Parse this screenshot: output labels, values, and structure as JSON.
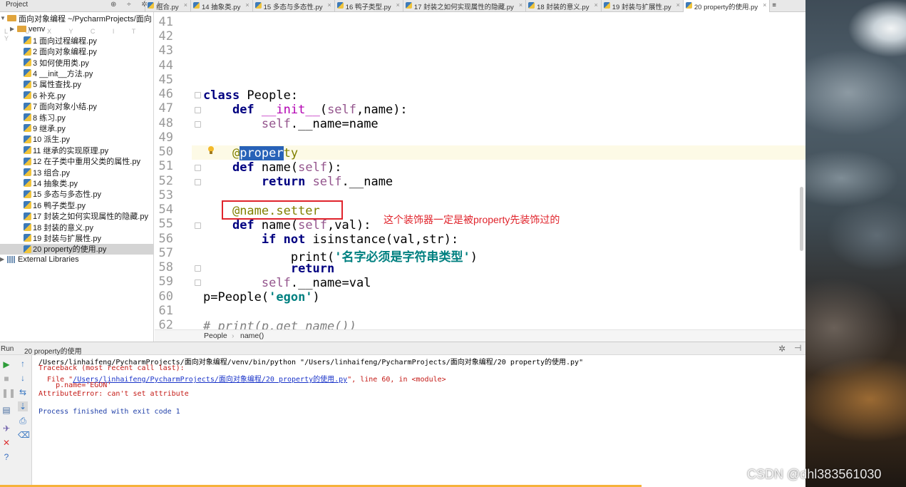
{
  "topbar": {
    "project_label": "Project",
    "tools": "⊕ ÷ ✲ ⊢",
    "tabs": [
      {
        "label": "组合.py",
        "active": false
      },
      {
        "label": "14 抽象类.py",
        "active": false
      },
      {
        "label": "15 多态与多态性.py",
        "active": false
      },
      {
        "label": "16 鸭子类型.py",
        "active": false
      },
      {
        "label": "17 封装之如何实现属性的隐藏.py",
        "active": false
      },
      {
        "label": "18 封装的意义.py",
        "active": false
      },
      {
        "label": "19 封装与扩展性.py",
        "active": false
      },
      {
        "label": "20 property的使用.py",
        "active": true
      }
    ],
    "overflow": "≡"
  },
  "sidebar": {
    "watermark": "L U X Y C I T Y",
    "root": "面向对象编程  ~/PycharmProjects/面向",
    "venv": "venv",
    "files": [
      "1 面向过程编程.py",
      "2 面向对象编程.py",
      "3 如何使用类.py",
      "4 __init__方法.py",
      "5 属性查找.py",
      "6 补充.py",
      "7 面向对象小结.py",
      "8 练习.py",
      "9 继承.py",
      "10 派生.py",
      "11 继承的实现原理.py",
      "12 在子类中重用父类的属性.py",
      "13 组合.py",
      "14 抽象类.py",
      "15 多态与多态性.py",
      "16 鸭子类型.py",
      "17 封装之如何实现属性的隐藏.py",
      "18 封装的意义.py",
      "19 封装与扩展性.py",
      "20 property的使用.py"
    ],
    "selected_index": 19,
    "external": "External Libraries"
  },
  "editor": {
    "line_numbers": [
      "41",
      "42",
      "43",
      "44",
      "45",
      "46",
      "47",
      "48",
      "49",
      "50",
      "51",
      "52",
      "53",
      "54",
      "55",
      "56",
      "57",
      "58",
      "59",
      "60",
      "61",
      "62"
    ],
    "current_line": "50",
    "annotation": "这个装饰器一定是被property先装饰过的",
    "breadcrumb": [
      "People",
      "name()"
    ]
  },
  "run": {
    "tab_label": "Run",
    "config": "20 property的使用",
    "console": {
      "cmd": "/Users/linhaifeng/PycharmProjects/面向对象编程/venv/bin/python \"/Users/linhaifeng/PycharmProjects/面向对象编程/20 property的使用.py\"",
      "traceback": "Traceback (most recent call last):",
      "file_prefix": "  File \"",
      "file_link": "/Users/linhaifeng/PycharmProjects/面向对象编程/20 property的使用.py",
      "file_suffix": "\", line 60, in <module>",
      "source": "    p.name='EGON'",
      "error": "AttributeError: can't set attribute",
      "finished": "Process finished with exit code 1"
    }
  },
  "watermark_csdn": "CSDN @dhl383561030",
  "colors": {
    "keyword": "#000080",
    "string": "#008080",
    "annotation": "#e0242c",
    "selection": "#2862b8"
  }
}
